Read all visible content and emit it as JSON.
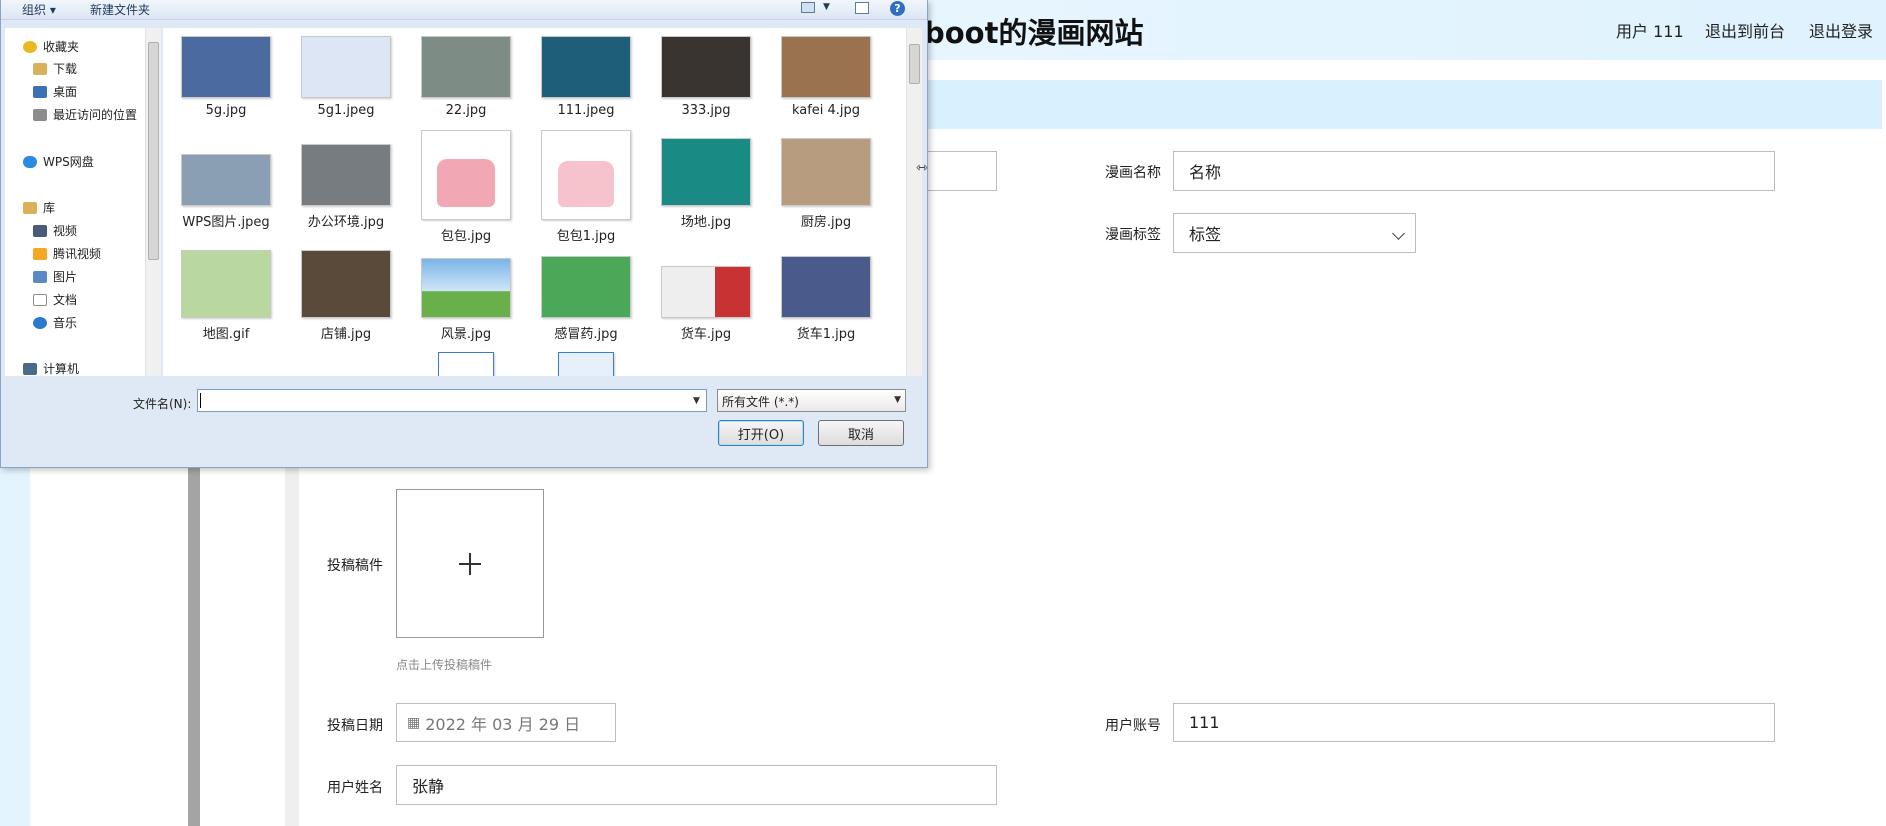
{
  "site": {
    "title": "boot的漫画网站",
    "nav": [
      "用户 111",
      "退出到前台",
      "退出登录"
    ]
  },
  "form": {
    "comic_name_label": "漫画名称",
    "comic_name_value": "名称",
    "comic_tag_label": "漫画标签",
    "comic_tag_value": "标签",
    "manuscript_label": "投稿稿件",
    "upload_hint": "点击上传投稿稿件",
    "date_label": "投稿日期",
    "date_value": "2022 年 03 月 29 日",
    "account_label": "用户账号",
    "account_value": "111",
    "username_label": "用户姓名",
    "username_value": "张静"
  },
  "dialog": {
    "toolbar": {
      "organize": "组织 ▾",
      "new_folder": "新建文件夹"
    },
    "tree": [
      {
        "label": "收藏夹",
        "icon": "star-icon",
        "color": "#e8b923"
      },
      {
        "label": "下载",
        "icon": "download-folder-icon",
        "color": "#d9b15a"
      },
      {
        "label": "桌面",
        "icon": "desktop-icon",
        "color": "#3b6fb6"
      },
      {
        "label": "最近访问的位置",
        "icon": "recent-places-icon",
        "color": "#8c8c8c"
      },
      {
        "label": "WPS网盘",
        "icon": "cloud-icon",
        "color": "#2a8be0"
      },
      {
        "label": "库",
        "icon": "library-icon",
        "color": "#d9b15a"
      },
      {
        "label": "视频",
        "icon": "video-icon",
        "color": "#4a5a78"
      },
      {
        "label": "腾讯视频",
        "icon": "tencent-video-icon",
        "color": "#f5a623"
      },
      {
        "label": "图片",
        "icon": "pictures-icon",
        "color": "#5a8ac6"
      },
      {
        "label": "文档",
        "icon": "documents-icon",
        "color": "#8c8c8c"
      },
      {
        "label": "音乐",
        "icon": "music-icon",
        "color": "#2a7bd0"
      },
      {
        "label": "计算机",
        "icon": "computer-icon",
        "color": "#4a6a8a"
      }
    ],
    "files": [
      {
        "name": "5g.jpg",
        "color": "#4a6aa0"
      },
      {
        "name": "5g1.jpeg",
        "color": "#dce6f4"
      },
      {
        "name": "22.jpg",
        "color": "#7e8c86"
      },
      {
        "name": "111.jpeg",
        "color": "#1e5e78"
      },
      {
        "name": "333.jpg",
        "color": "#3a3430"
      },
      {
        "name": "kafei 4.jpg",
        "color": "#9a7250"
      },
      {
        "name": "WPS图片.jpeg",
        "color": "#8a9eb4"
      },
      {
        "name": "办公环境.jpg",
        "color": "#767c80"
      },
      {
        "name": "包包.jpg",
        "color": "#f2a8b4"
      },
      {
        "name": "包包1.jpg",
        "color": "#f6c2cc"
      },
      {
        "name": "场地.jpg",
        "color": "#1a8a84"
      },
      {
        "name": "厨房.jpg",
        "color": "#b89c80"
      },
      {
        "name": "地图.gif",
        "color": "#b8d8a0"
      },
      {
        "name": "店铺.jpg",
        "color": "#5a4a3a"
      },
      {
        "name": "风景.jpg",
        "color": "#6ab04a"
      },
      {
        "name": "感冒药.jpg",
        "color": "#4aa858"
      },
      {
        "name": "货车.jpg",
        "color": "#c83232"
      },
      {
        "name": "货车1.jpg",
        "color": "#4a5a8a"
      }
    ],
    "filename_label": "文件名(N):",
    "filename_value": "",
    "filetype": "所有文件 (*.*)",
    "open_button": "打开(O)",
    "cancel_button": "取消"
  }
}
